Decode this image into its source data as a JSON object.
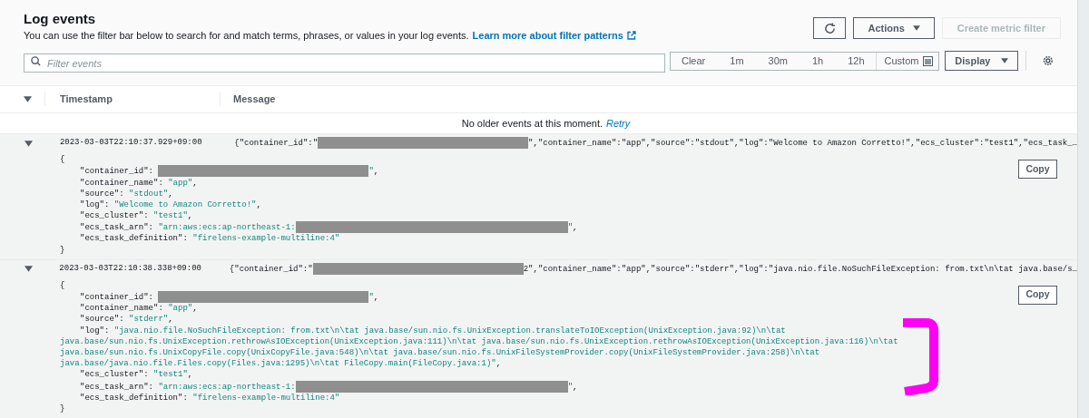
{
  "header": {
    "title": "Log events",
    "description": "You can use the filter bar below to search for and match terms, phrases, or values in your log events.",
    "link": "Learn more about filter patterns"
  },
  "actions": [
    {
      "kind": "refresh",
      "disabled": false
    },
    {
      "kind": "dropdown",
      "label": "Actions",
      "disabled": false
    },
    {
      "kind": "plain",
      "label": "Create metric filter",
      "disabled": true
    }
  ],
  "filter": {
    "placeholder": "Filter events",
    "ranges": [
      "Clear",
      "1m",
      "30m",
      "1h",
      "12h"
    ],
    "custom": "Custom",
    "display": "Display"
  },
  "columns": [
    "Timestamp",
    "Message"
  ],
  "notice": {
    "text": "No older events at this moment.",
    "link": "Retry"
  },
  "events": [
    {
      "timestamp": "2023-03-03T22:10:37.929+09:00",
      "expanded": true,
      "summary": [
        {
          "kind": "plain",
          "text": "{\"container_id\":\""
        },
        {
          "kind": "redacted_id"
        },
        {
          "kind": "plain",
          "text": "\",\"container_name\":\"app\",\"source\":\"stdout\",\"log\":\"Welcome to Amazon Corretto!\",\"ecs_cluster\":\"test1\",\"ecs_task_…"
        }
      ],
      "copy": "Copy",
      "lines": [
        [
          {
            "kind": "plain",
            "text": "{"
          }
        ],
        [
          {
            "kind": "indent"
          },
          {
            "kind": "plain",
            "text": "\"container_id\": "
          },
          {
            "kind": "redacted_id"
          },
          {
            "kind": "string",
            "text": "\""
          },
          {
            "kind": "plain",
            "text": ","
          }
        ],
        [
          {
            "kind": "indent"
          },
          {
            "kind": "plain",
            "text": "\"container_name\": "
          },
          {
            "kind": "string",
            "text": "\"app\""
          },
          {
            "kind": "plain",
            "text": ","
          }
        ],
        [
          {
            "kind": "indent"
          },
          {
            "kind": "plain",
            "text": "\"source\": "
          },
          {
            "kind": "string",
            "text": "\"stdout\""
          },
          {
            "kind": "plain",
            "text": ","
          }
        ],
        [
          {
            "kind": "indent"
          },
          {
            "kind": "plain",
            "text": "\"log\": "
          },
          {
            "kind": "string",
            "text": "\"Welcome to Amazon Corretto!\""
          },
          {
            "kind": "plain",
            "text": ","
          }
        ],
        [
          {
            "kind": "indent"
          },
          {
            "kind": "plain",
            "text": "\"ecs_cluster\": "
          },
          {
            "kind": "string",
            "text": "\"test1\""
          },
          {
            "kind": "plain",
            "text": ","
          }
        ],
        [
          {
            "kind": "indent"
          },
          {
            "kind": "plain",
            "text": "\"ecs_task_arn\": "
          },
          {
            "kind": "string",
            "text": "\"arn:aws:ecs:ap-northeast-1:"
          },
          {
            "kind": "redacted_arn"
          },
          {
            "kind": "string",
            "text": "\""
          },
          {
            "kind": "plain",
            "text": ","
          }
        ],
        [
          {
            "kind": "indent"
          },
          {
            "kind": "plain",
            "text": "\"ecs_task_definition\": "
          },
          {
            "kind": "string",
            "text": "\"firelens-example-multiline:4\""
          }
        ],
        [
          {
            "kind": "plain",
            "text": "}"
          }
        ]
      ]
    },
    {
      "timestamp": "2023-03-03T22:10:38.338+09:00",
      "expanded": true,
      "summary": [
        {
          "kind": "plain",
          "text": "{\"container_id\":\""
        },
        {
          "kind": "redacted_id"
        },
        {
          "kind": "plain",
          "text": "2\",\"container_name\":\"app\",\"source\":\"stderr\",\"log\":\"java.nio.file.NoSuchFileException: from.txt\\n\\tat java.base/s…"
        }
      ],
      "copy": "Copy",
      "lines": [
        [
          {
            "kind": "plain",
            "text": "{"
          }
        ],
        [
          {
            "kind": "indent"
          },
          {
            "kind": "plain",
            "text": "\"container_id\": "
          },
          {
            "kind": "redacted_id"
          },
          {
            "kind": "string",
            "text": "\""
          },
          {
            "kind": "plain",
            "text": ","
          }
        ],
        [
          {
            "kind": "indent"
          },
          {
            "kind": "plain",
            "text": "\"container_name\": "
          },
          {
            "kind": "string",
            "text": "\"app\""
          },
          {
            "kind": "plain",
            "text": ","
          }
        ],
        [
          {
            "kind": "indent"
          },
          {
            "kind": "plain",
            "text": "\"source\": "
          },
          {
            "kind": "string",
            "text": "\"stderr\""
          },
          {
            "kind": "plain",
            "text": ","
          }
        ],
        [
          {
            "kind": "indent"
          },
          {
            "kind": "plain",
            "text": "\"log\": "
          },
          {
            "kind": "string",
            "text": "\"java.nio.file.NoSuchFileException: from.txt\\n\\tat java.base/sun.nio.fs.UnixException.translateToIOException(UnixException.java:92)\\n\\tat"
          }
        ],
        [
          {
            "kind": "string",
            "text": "java.base/sun.nio.fs.UnixException.rethrowAsIOException(UnixException.java:111)\\n\\tat java.base/sun.nio.fs.UnixException.rethrowAsIOException(UnixException.java:116)\\n\\tat"
          }
        ],
        [
          {
            "kind": "string",
            "text": "java.base/sun.nio.fs.UnixCopyFile.copy(UnixCopyFile.java:548)\\n\\tat java.base/sun.nio.fs.UnixFileSystemProvider.copy(UnixFileSystemProvider.java:258)\\n\\tat"
          }
        ],
        [
          {
            "kind": "string",
            "text": "java.base/java.nio.file.Files.copy(Files.java:1295)\\n\\tat FileCopy.main(FileCopy.java:1)\""
          },
          {
            "kind": "plain",
            "text": ","
          }
        ],
        [
          {
            "kind": "indent"
          },
          {
            "kind": "plain",
            "text": "\"ecs_cluster\": "
          },
          {
            "kind": "string",
            "text": "\"test1\""
          },
          {
            "kind": "plain",
            "text": ","
          }
        ],
        [
          {
            "kind": "indent"
          },
          {
            "kind": "plain",
            "text": "\"ecs_task_arn\": "
          },
          {
            "kind": "string",
            "text": "\"arn:aws:ecs:ap-northeast-1:"
          },
          {
            "kind": "redacted_arn"
          },
          {
            "kind": "string",
            "text": "\""
          },
          {
            "kind": "plain",
            "text": ","
          }
        ],
        [
          {
            "kind": "indent"
          },
          {
            "kind": "plain",
            "text": "\"ecs_task_definition\": "
          },
          {
            "kind": "string",
            "text": "\"firelens-example-multiline:4\""
          }
        ],
        [
          {
            "kind": "plain",
            "text": "}"
          }
        ]
      ]
    }
  ]
}
